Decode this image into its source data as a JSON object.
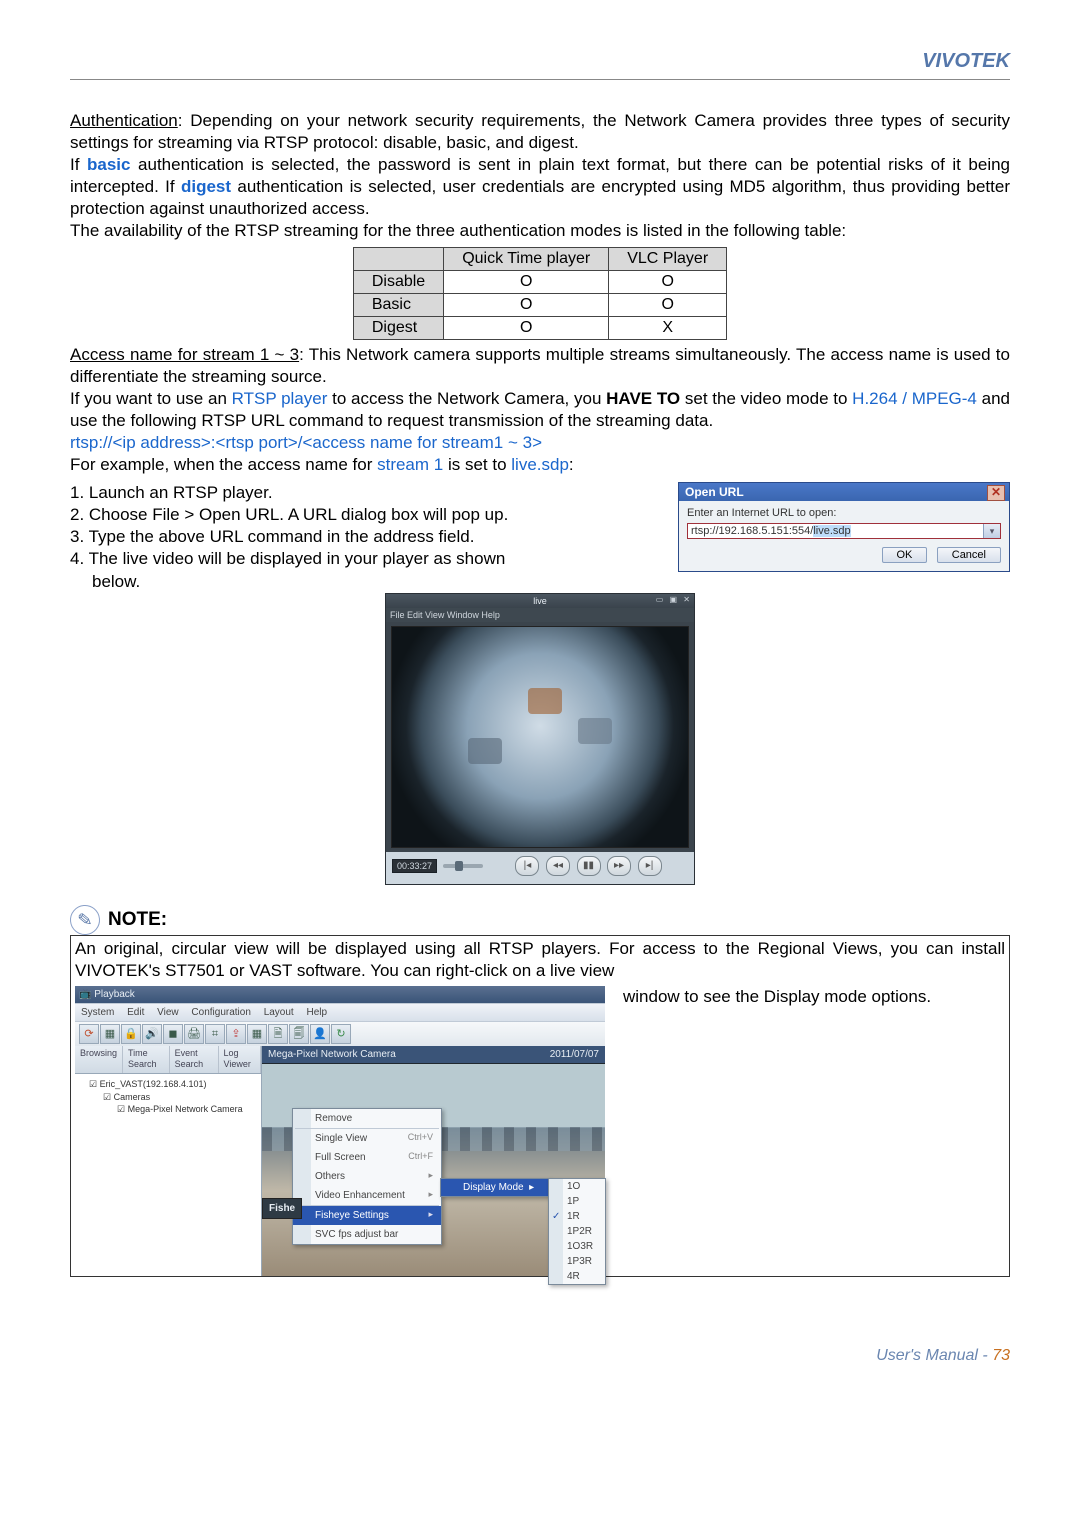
{
  "brand": "VIVOTEK",
  "paragraphs": {
    "auth_intro": "Authentication: Depending on your network security requirements, the Network Camera provides three types of security settings for streaming via RTSP protocol: disable, basic, and digest.",
    "auth_if": "If ",
    "auth_basic": "basic",
    "auth_basic_rest": " authentication is selected, the password is sent in plain text format, but there can be potential risks of it being intercepted. If ",
    "auth_digest": "digest",
    "auth_digest_rest": " authentication is selected, user credentials are encrypted using MD5 algorithm, thus providing better protection against unauthorized access.",
    "auth_avail": "The availability of the RTSP streaming for the three authentication modes is listed in the following table:",
    "access_intro_u": "Access name for stream 1 ~ 3",
    "access_intro_rest": ": This Network camera supports multiple streams simultaneously. The access name is used to differentiate the streaming source.",
    "access_if": "If you want to use an ",
    "rtsp_player": "RTSP player",
    "access_if2": " to access the Network Camera, you ",
    "have_to": "HAVE TO",
    "access_if3": " set the video mode to ",
    "codecs": "H.264 / MPEG-4",
    "access_if4": " and use the following RTSP URL command to request transmission of the streaming data.",
    "rtsp_url": "rtsp://<ip address>:<rtsp port>/<access name for stream1 ~ 3>",
    "example_pre": "For example, when the access name for ",
    "stream1": "stream 1",
    "example_mid": " is set to ",
    "livesdp": "live.sdp",
    "example_end": ":",
    "step1": "1. Launch an RTSP player.",
    "step2": "2. Choose File > Open URL. A URL dialog box will pop up.",
    "step3": "3. Type the above URL command in the address field.",
    "step4a": "4. The live video will be displayed in your player as shown",
    "step4b": "below."
  },
  "auth_table": {
    "col_qt": "Quick Time player",
    "col_vlc": "VLC Player",
    "rows": [
      {
        "label": "Disable",
        "qt": "O",
        "vlc": "O"
      },
      {
        "label": "Basic",
        "qt": "O",
        "vlc": "O"
      },
      {
        "label": "Digest",
        "qt": "O",
        "vlc": "X"
      }
    ]
  },
  "open_url": {
    "title": "Open URL",
    "label": "Enter an Internet URL to open:",
    "value_a": "rtsp://192.168.5.151:554/",
    "value_b": "live.sdp",
    "ok": "OK",
    "cancel": "Cancel"
  },
  "player": {
    "menubar": "File  Edit  View  Window  Help",
    "title_mid": "live",
    "winbtns": "▭ ▣ ✕",
    "timestamp": "00:33:27",
    "btn_rw": "|◂",
    "btn_prev": "◂◂",
    "btn_pause": "▮▮",
    "btn_next": "▸▸",
    "btn_ff": "▸|"
  },
  "note": {
    "heading": "NOTE:",
    "text_a": "An original, circular view will be displayed using all RTSP players. For access to the Regional Views, you can install VIVOTEK's ST7501 or VAST software. You can right-click on a live view",
    "text_b": "window to see the Display mode options."
  },
  "vast": {
    "titlebar": "Playback",
    "menu": [
      "System",
      "Edit",
      "View",
      "Configuration",
      "Layout",
      "Help"
    ],
    "toolbar_icons": [
      "⟳",
      "▦",
      "🔒",
      "🔊",
      "◼",
      "🖨",
      "⌗",
      "⇪",
      "▦",
      "🗎",
      "🗐",
      "👤",
      "↻"
    ],
    "tabs": [
      "Browsing",
      "Time Search",
      "Event Search",
      "Log Viewer"
    ],
    "tree": {
      "root": "☑ Eric_VAST(192.168.4.101)",
      "cameras": "☑ Cameras",
      "cam1": "☑ Mega-Pixel Network Camera"
    },
    "view_header_left": "Mega-Pixel Network Camera",
    "view_header_right": "2011/07/07",
    "ctx": {
      "remove": "Remove",
      "single": "Single View",
      "single_kc": "Ctrl+V",
      "full": "Full Screen",
      "full_kc": "Ctrl+F",
      "others": "Others",
      "enh": "Video Enhancement",
      "fisheye": "Fisheye Settings",
      "svc": "SVC fps adjust bar"
    },
    "submenu": {
      "display": "Display Mode"
    },
    "modes": [
      "1O",
      "1P",
      "1R",
      "1P2R",
      "1O3R",
      "1P3R",
      "4R"
    ],
    "checked_mode": "1R",
    "splitter": "Fishe"
  },
  "footer": {
    "label": "User's Manual - ",
    "page": "73"
  }
}
